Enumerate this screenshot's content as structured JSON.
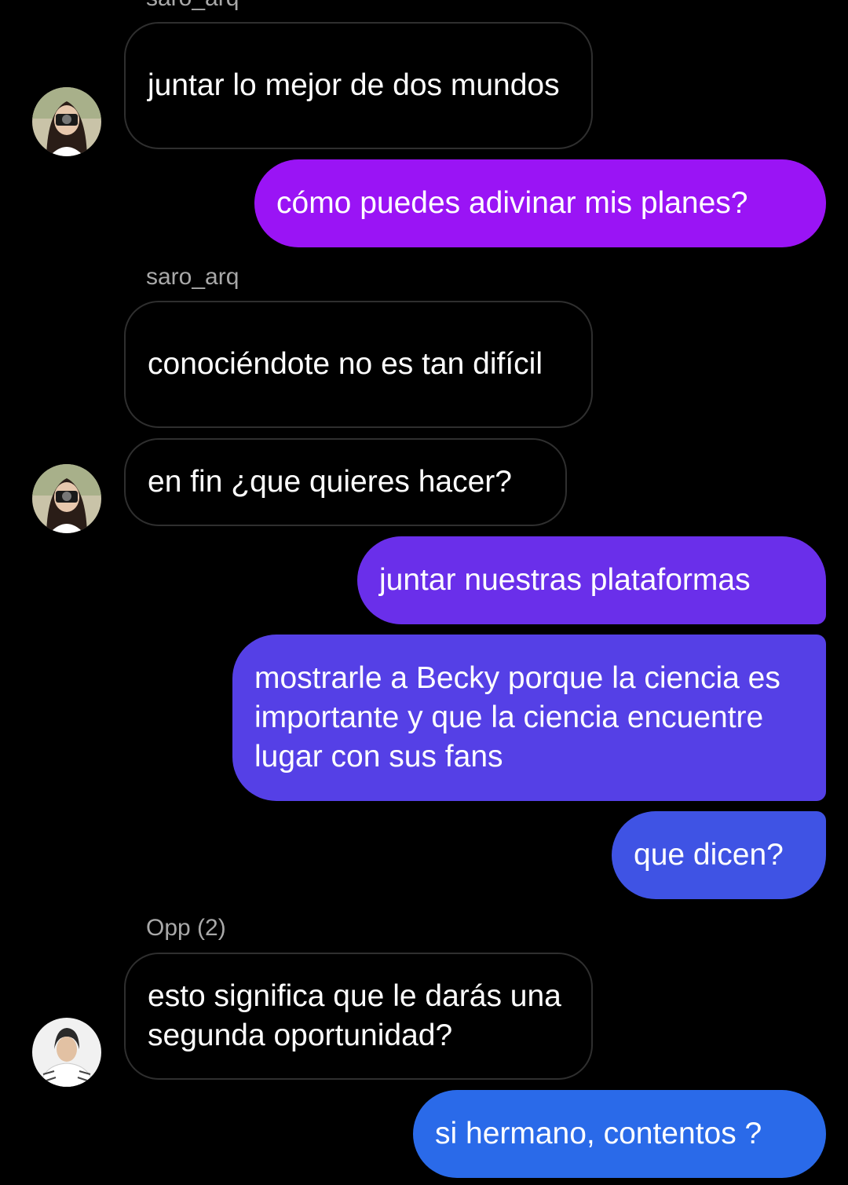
{
  "messages": [
    {
      "sender_label": "saro_arq"
    },
    {
      "text": "juntar lo mejor de dos mundos",
      "direction": "in"
    },
    {
      "text": "cómo puedes adivinar mis planes?",
      "direction": "out",
      "color": "#9A14F5"
    },
    {
      "sender_label": "saro_arq"
    },
    {
      "text": "conociéndote no es tan difícil",
      "direction": "in"
    },
    {
      "text": "en fin ¿que quieres hacer?",
      "direction": "in"
    },
    {
      "text": "juntar nuestras plataformas",
      "direction": "out",
      "color": "#6A2FEA"
    },
    {
      "text": "mostrarle a Becky porque la ciencia es importante y que la ciencia encuentre lugar con sus fans",
      "direction": "out",
      "color": "#5540E6"
    },
    {
      "text": "que dicen?",
      "direction": "out",
      "color": "#3F53E4"
    },
    {
      "sender_label": "Opp (2)"
    },
    {
      "text": "esto significa que le darás una segunda oportunidad?",
      "direction": "in"
    },
    {
      "text": "si hermano, contentos ?",
      "direction": "out",
      "color": "#2A6AE9"
    }
  ],
  "avatars": [
    {
      "name": "saro_arq",
      "icon": "person-with-camera-avatar"
    },
    {
      "name": "saro_arq",
      "icon": "person-with-camera-avatar"
    },
    {
      "name": "Opp (2)",
      "icon": "person-portrait-avatar"
    }
  ]
}
